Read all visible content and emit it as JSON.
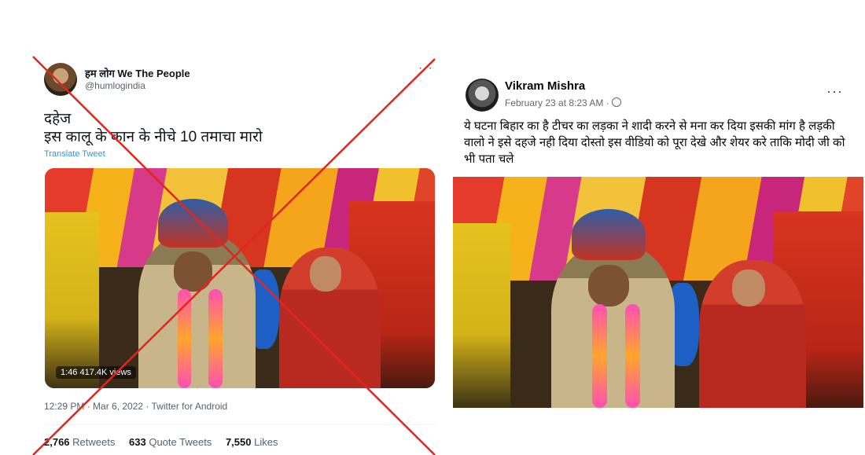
{
  "tweet": {
    "display_name": "हम लोग We The People",
    "handle": "@humlogindia",
    "more": "···",
    "text": "दहेज\nइस कालू के कान के नीचे 10 तमाचा मारो",
    "translate_label": "Translate Tweet",
    "video_meta": "1:46  417.4K views",
    "timestamp": "12:29 PM · Mar 6, 2022 · Twitter for Android",
    "stats": {
      "retweets_count": "2,766",
      "retweets_label": "Retweets",
      "quote_count": "633",
      "quote_label": "Quote Tweets",
      "likes_count": "7,550",
      "likes_label": "Likes"
    }
  },
  "facebook_post": {
    "author": "Vikram Mishra",
    "date": "February 23 at 8:23 AM ·",
    "more": "···",
    "text": "ये घटना बिहार का है टीचर का लड़का ने शादी करने से मना कर दिया इसकी मांग है  लड़की वालो ने इसे दहजे नही दिया दोस्तो इस वीडियो को पूरा देखे और शेयर करे ताकि मोदी जी को भी पता चले"
  },
  "colors": {
    "cross_red": "#e0261f",
    "twitter_blue": "#1d9bf0",
    "muted_gray": "#536471"
  }
}
